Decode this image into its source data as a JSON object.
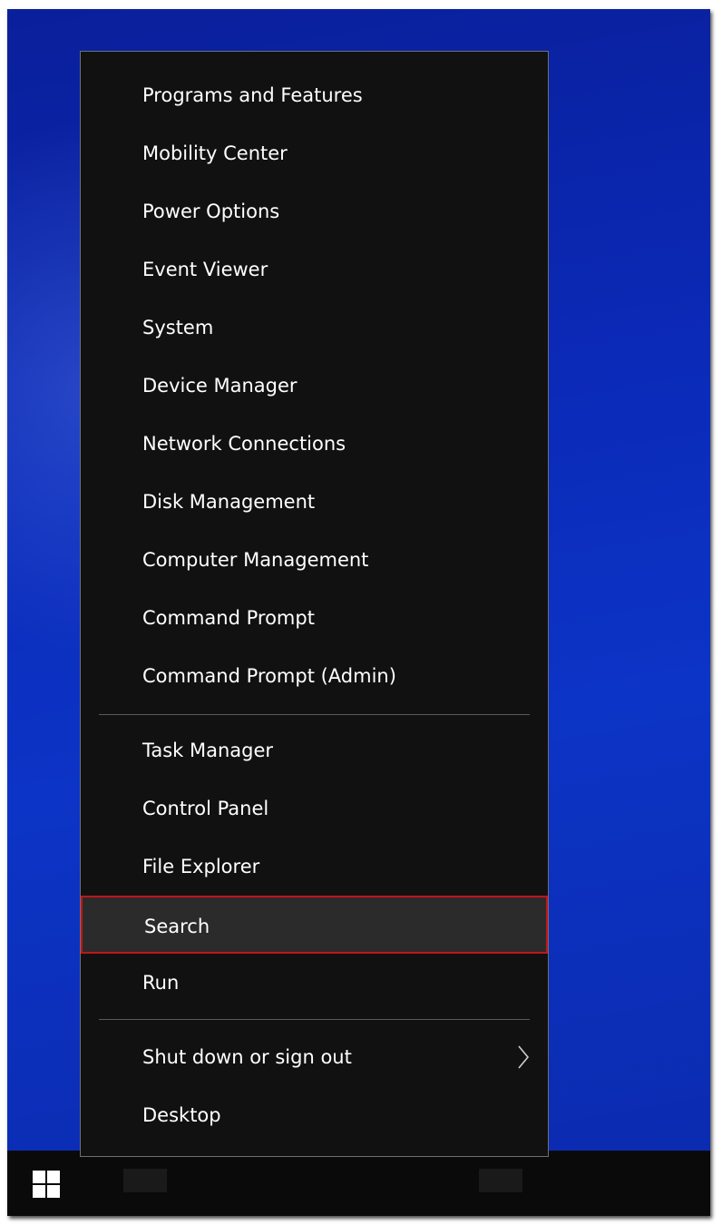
{
  "menu": {
    "items": [
      "Programs and Features",
      "Mobility Center",
      "Power Options",
      "Event Viewer",
      "System",
      "Device Manager",
      "Network Connections",
      "Disk Management",
      "Computer Management",
      "Command Prompt",
      "Command Prompt (Admin)",
      "Task Manager",
      "Control Panel",
      "File Explorer",
      "Search",
      "Run",
      "Shut down or sign out",
      "Desktop"
    ],
    "highlighted_item": "Search",
    "submenu_chevron": "chevron-right-icon"
  },
  "taskbar": {
    "start_icon": "windows-logo-icon"
  },
  "colors": {
    "menu_background": "#111111",
    "highlight_border": "#c0151b",
    "desktop_blue": "#0b2ab8"
  }
}
